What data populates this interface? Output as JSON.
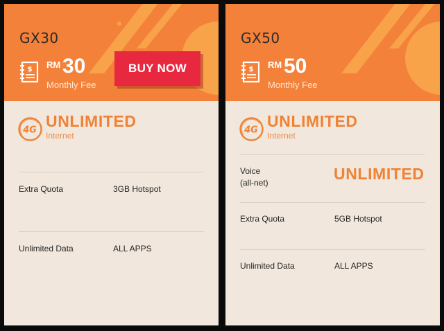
{
  "plans": [
    {
      "name": "GX30",
      "currency": "RM",
      "amount": "30",
      "fee_label": "Monthly Fee",
      "buy_label": "BUY NOW",
      "network_badge": "4G",
      "internet_title": "UNLIMITED",
      "internet_sub": "Internet",
      "rows": [
        {
          "label": "Extra Quota",
          "value": "3GB Hotspot"
        },
        {
          "label": "Unlimited Data",
          "value": "ALL APPS"
        }
      ]
    },
    {
      "name": "GX50",
      "currency": "RM",
      "amount": "50",
      "fee_label": "Monthly Fee",
      "network_badge": "4G",
      "internet_title": "UNLIMITED",
      "internet_sub": "Internet",
      "voice": {
        "label_line1": "Voice",
        "label_line2": "(all-net)",
        "value": "UNLIMITED"
      },
      "rows": [
        {
          "label": "Extra Quota",
          "value": "5GB Hotspot"
        },
        {
          "label": "Unlimited Data",
          "value": "ALL APPS"
        }
      ]
    }
  ],
  "colors": {
    "header": "#f3813a",
    "body": "#f1e7dc",
    "accent": "#ef8234",
    "button": "#e8283f",
    "frame": "#0a0a0a"
  },
  "icons": {
    "fee": "bill-icon",
    "network": "4g-icon"
  }
}
